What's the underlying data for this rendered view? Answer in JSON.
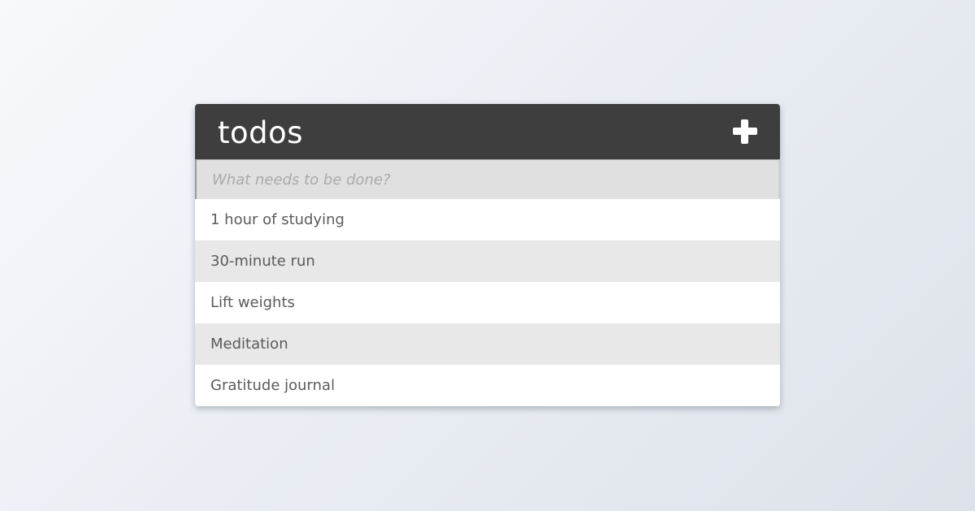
{
  "header": {
    "title": "todos",
    "add_icon": "plus-icon"
  },
  "input": {
    "value": "",
    "placeholder": "What needs to be done?"
  },
  "todos": [
    {
      "label": "1 hour of studying"
    },
    {
      "label": "30-minute run"
    },
    {
      "label": "Lift weights"
    },
    {
      "label": "Meditation"
    },
    {
      "label": "Gratitude journal"
    }
  ],
  "colors": {
    "header_bg": "#3e3e3e",
    "input_bg": "#e0e0e0",
    "row_alt_bg": "#e8e8e8",
    "row_bg": "#ffffff",
    "text": "#5a5a5a"
  }
}
